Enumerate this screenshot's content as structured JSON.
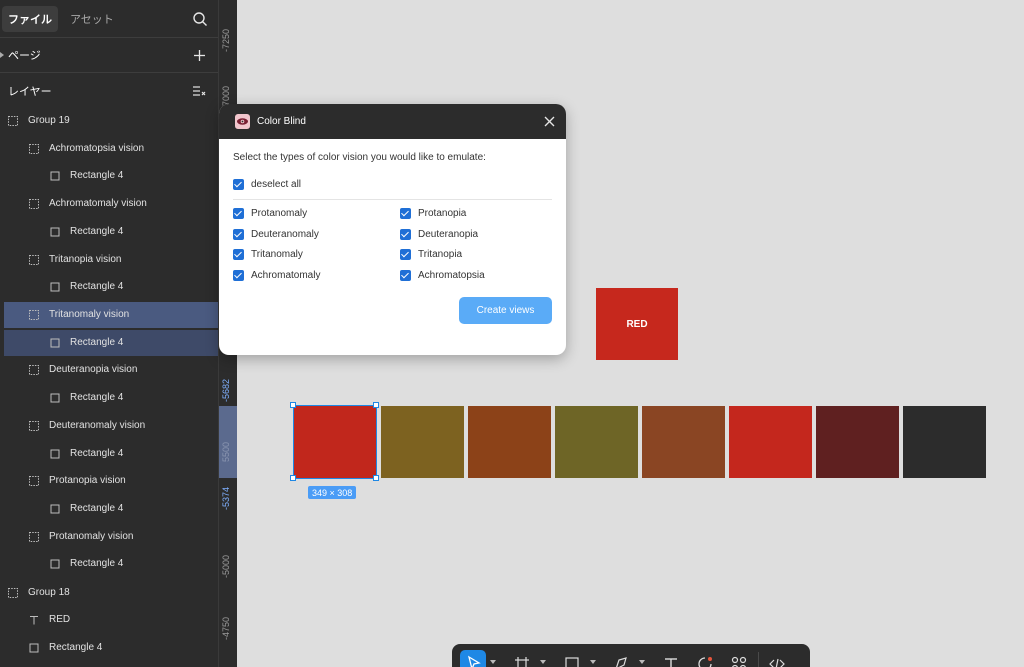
{
  "sidebar": {
    "tabs": [
      {
        "label": "ファイル",
        "active": true
      },
      {
        "label": "アセット",
        "active": false
      }
    ],
    "pages_label": "ページ",
    "layers_label": "レイヤー",
    "layers": [
      {
        "label": "Group 19",
        "icon": "frame-icon"
      },
      {
        "label": "Achromatopsia vision",
        "icon": "frame-icon"
      },
      {
        "label": "Rectangle 4",
        "icon": "rectangle-icon"
      },
      {
        "label": "Achromatomaly vision",
        "icon": "frame-icon"
      },
      {
        "label": "Rectangle 4",
        "icon": "rectangle-icon"
      },
      {
        "label": "Tritanopia vision",
        "icon": "frame-icon"
      },
      {
        "label": "Rectangle 4",
        "icon": "rectangle-icon"
      },
      {
        "label": "Tritanomaly vision",
        "icon": "frame-icon",
        "selected": true
      },
      {
        "label": "Rectangle 4",
        "icon": "rectangle-icon",
        "selected": true
      },
      {
        "label": "Deuteranopia vision",
        "icon": "frame-icon"
      },
      {
        "label": "Rectangle 4",
        "icon": "rectangle-icon"
      },
      {
        "label": "Deuteranomaly vision",
        "icon": "frame-icon"
      },
      {
        "label": "Rectangle 4",
        "icon": "rectangle-icon"
      },
      {
        "label": "Protanopia vision",
        "icon": "frame-icon"
      },
      {
        "label": "Rectangle 4",
        "icon": "rectangle-icon"
      },
      {
        "label": "Protanomaly vision",
        "icon": "frame-icon"
      },
      {
        "label": "Rectangle 4",
        "icon": "rectangle-icon"
      },
      {
        "label": "Group 18",
        "icon": "frame-icon"
      },
      {
        "label": "RED",
        "icon": "text-icon"
      },
      {
        "label": "Rectangle 4",
        "icon": "rectangle-icon"
      }
    ]
  },
  "ruler": {
    "labels": [
      "-7250",
      "7000",
      "-5682",
      "5500",
      "-5374",
      "-5000",
      "-4750"
    ]
  },
  "dialog": {
    "title": "Color Blind",
    "prompt": "Select the types of color vision you would like to emulate:",
    "deselect_all": "deselect all",
    "options_left": [
      "Protanomaly",
      "Deuteranomaly",
      "Tritanomaly",
      "Achromatomaly"
    ],
    "options_right": [
      "Protanopia",
      "Deuteranopia",
      "Tritanopia",
      "Achromatopsia"
    ],
    "create_button": "Create views"
  },
  "canvas": {
    "red_label": "RED",
    "red_color": "#c6281d",
    "swatch_colors": [
      "#c1271c",
      "#7d6220",
      "#8c4218",
      "#6e6526",
      "#8a4523",
      "#c4271d",
      "#5f2020",
      "#2c2c2c"
    ],
    "selection_size": "349 × 308"
  },
  "colors": {
    "accent": "#1e88e5",
    "panel": "#2c2c2c",
    "checkbox": "#1f6fd6",
    "button": "#5aabf7"
  }
}
